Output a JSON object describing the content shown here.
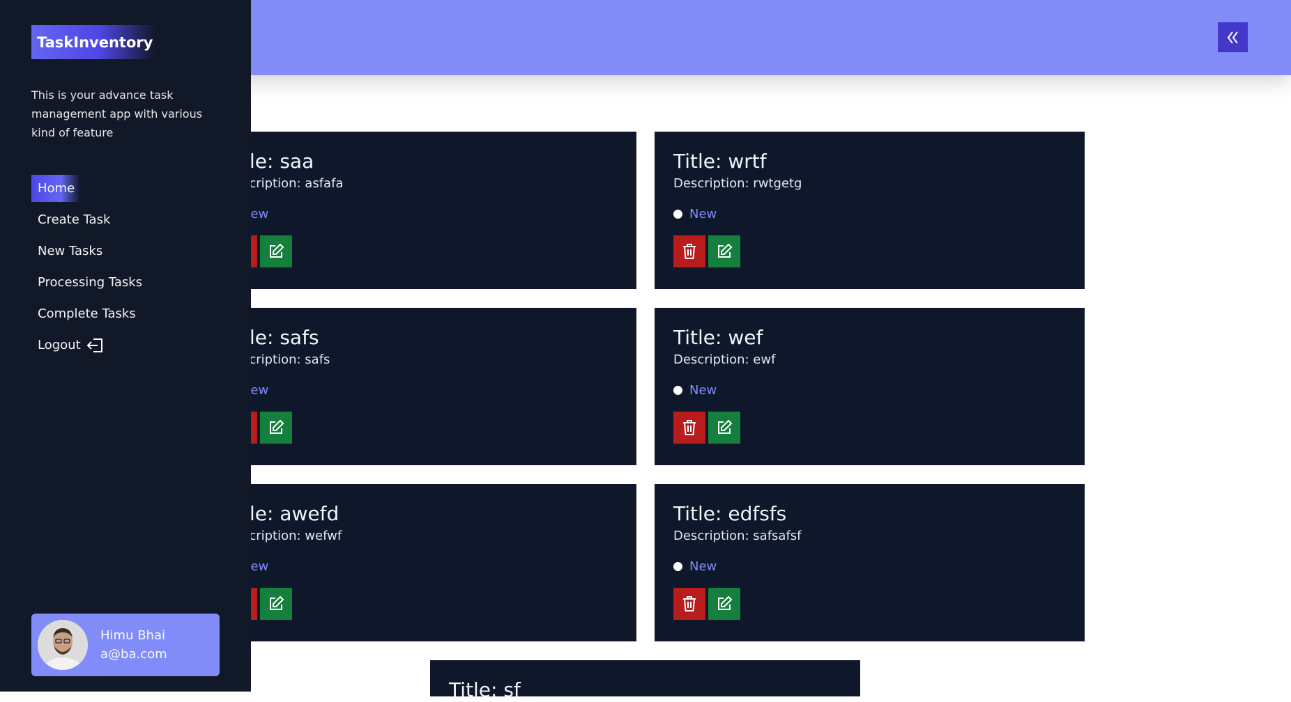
{
  "sidebar": {
    "logo": "TaskInventory",
    "tagline": "This is your advance task management app with various kind of feature",
    "nav": [
      {
        "label": "Home",
        "active": true
      },
      {
        "label": "Create Task"
      },
      {
        "label": "New Tasks"
      },
      {
        "label": "Processing Tasks"
      },
      {
        "label": "Complete Tasks"
      },
      {
        "label": "Logout",
        "icon": "logout-icon"
      }
    ],
    "user": {
      "name": "Himu Bhai",
      "email": "a@ba.com"
    }
  },
  "header": {
    "collapse_icon": "double-chevron-left-icon"
  },
  "tasks": [
    {
      "title": "Title: saa",
      "description": "Description: asfafa",
      "status": "New"
    },
    {
      "title": "Title: wrtf",
      "description": "Description: rwtgetg",
      "status": "New"
    },
    {
      "title": "Title: safs",
      "description": "Description: safs",
      "status": "New"
    },
    {
      "title": "Title: wef",
      "description": "Description: ewf",
      "status": "New"
    },
    {
      "title": "Title: awefd",
      "description": "Description: wefwf",
      "status": "New"
    },
    {
      "title": "Title: edfsfs",
      "description": "Description: safsafsf",
      "status": "New"
    },
    {
      "title": "Title: sf"
    }
  ],
  "colors": {
    "sidebar_bg": "#111827",
    "header_bg": "#818cf8",
    "card_bg": "#0f172a",
    "delete": "#b91c1c",
    "edit": "#15803d",
    "accent": "#818cf8"
  }
}
